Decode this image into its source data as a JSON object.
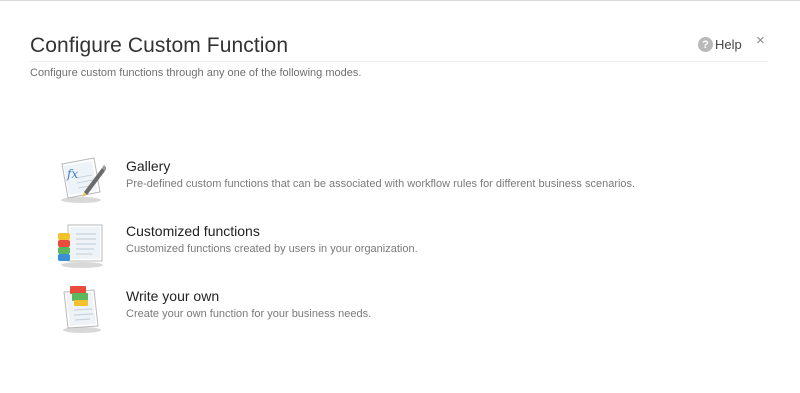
{
  "dialog": {
    "title": "Configure Custom Function",
    "subtitle": "Configure custom functions through any one of the following modes.",
    "help_label": "Help",
    "help_icon": "?",
    "close_icon": "×"
  },
  "options": [
    {
      "label": "Gallery",
      "description": "Pre-defined custom functions that can be associated with workflow rules for different business scenarios.",
      "icon": "fx-pen-document-icon"
    },
    {
      "label": "Customized functions",
      "description": "Customized functions created by users in your organization.",
      "icon": "stacked-documents-icon"
    },
    {
      "label": "Write your own",
      "description": "Create your own function for your business needs.",
      "icon": "write-document-icon"
    }
  ]
}
